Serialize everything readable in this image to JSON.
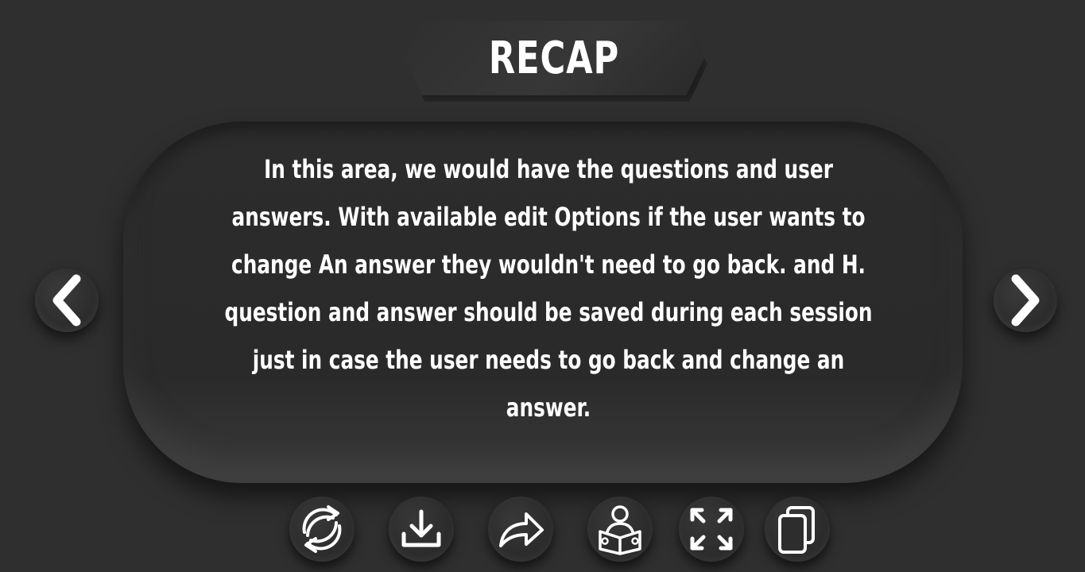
{
  "header": {
    "title": "RECAP"
  },
  "card": {
    "body_text": "In this area, we would have the questions and user answers. With available edit Options if the user wants to change An answer they wouldn't need to go back. and H. question and answer should be saved during each session just in case the user needs to go back and change an answer."
  },
  "navigation": {
    "prev_icon": "chevron-left-icon",
    "next_icon": "chevron-right-icon"
  },
  "toolbar": {
    "items": [
      {
        "icon": "refresh-icon"
      },
      {
        "icon": "download-icon"
      },
      {
        "icon": "share-icon"
      },
      {
        "icon": "reader-icon"
      },
      {
        "icon": "fullscreen-icon"
      },
      {
        "icon": "copy-icon"
      }
    ]
  },
  "colors": {
    "background": "#2f2f2f",
    "foreground": "#ffffff"
  }
}
